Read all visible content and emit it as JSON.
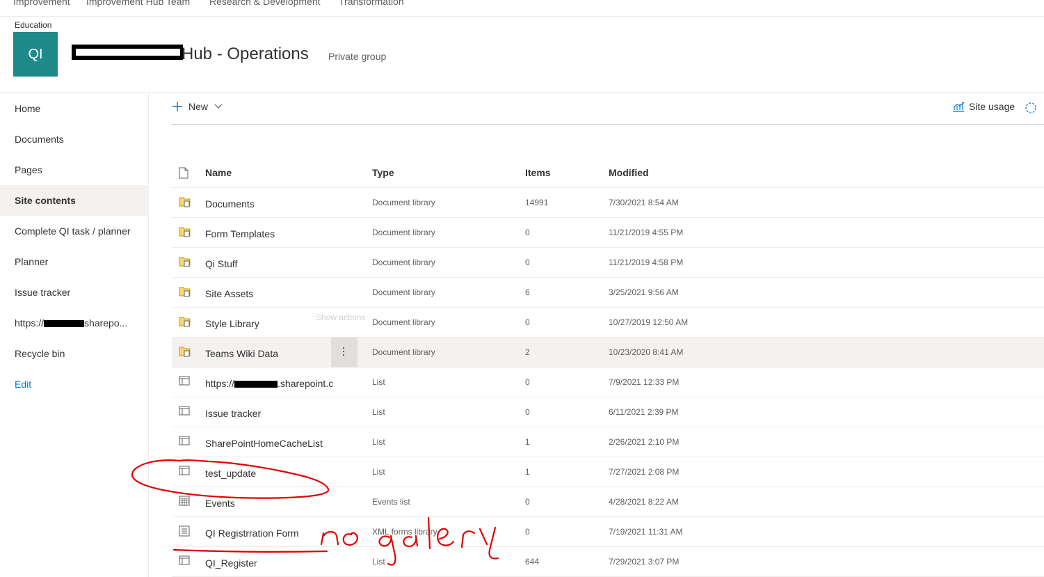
{
  "topnav": {
    "items": [
      "Improvement",
      "Improvement Hub Team",
      "Research & Development",
      "Transformation"
    ]
  },
  "header": {
    "hub_label": "Education",
    "logo_text": "QI",
    "title": "Hub - Operations",
    "group_type": "Private group"
  },
  "leftnav": {
    "items": [
      "Home",
      "Documents",
      "Pages",
      "Site contents",
      "Complete QI task / planner",
      "Planner",
      "Issue tracker",
      "Recycle bin",
      "Edit"
    ],
    "link_prefix": "https://",
    "link_suffix": "sharepo..."
  },
  "commandbar": {
    "new_label": "New",
    "site_usage_label": "Site usage"
  },
  "table": {
    "headers": {
      "name": "Name",
      "type": "Type",
      "items": "Items",
      "modified": "Modified"
    },
    "tooltip": "Show actions",
    "rows": [
      {
        "name": "Documents",
        "type": "Document library",
        "items": "14991",
        "modified": "7/30/2021 8:54 AM",
        "icon": "document-library-icon"
      },
      {
        "name": "Form Templates",
        "type": "Document library",
        "items": "0",
        "modified": "11/21/2019 4:55 PM",
        "icon": "document-library-icon"
      },
      {
        "name": "Qi Stuff",
        "type": "Document library",
        "items": "0",
        "modified": "11/21/2019 4:58 PM",
        "icon": "document-library-icon"
      },
      {
        "name": "Site Assets",
        "type": "Document library",
        "items": "6",
        "modified": "3/25/2021 9:56 AM",
        "icon": "document-library-icon"
      },
      {
        "name": "Style Library",
        "type": "Document library",
        "items": "0",
        "modified": "10/27/2019 12:50 AM",
        "icon": "document-library-icon"
      },
      {
        "name": "Teams Wiki Data",
        "type": "Document library",
        "items": "2",
        "modified": "10/23/2020 8:41 AM",
        "icon": "document-library-icon"
      },
      {
        "name_prefix": "https://",
        "name_suffix": ".sharepoint.c",
        "type": "List",
        "items": "0",
        "modified": "7/9/2021 12:33 PM",
        "icon": "list-icon"
      },
      {
        "name": "Issue tracker",
        "type": "List",
        "items": "0",
        "modified": "6/11/2021 2:39 PM",
        "icon": "list-icon"
      },
      {
        "name": "SharePointHomeCacheList",
        "type": "List",
        "items": "1",
        "modified": "2/26/2021 2:10 PM",
        "icon": "list-icon"
      },
      {
        "name": "test_update",
        "type": "List",
        "items": "1",
        "modified": "7/27/2021 2:08 PM",
        "icon": "list-icon"
      },
      {
        "name": "Events",
        "type": "Events list",
        "items": "0",
        "modified": "4/28/2021 8:22 AM",
        "icon": "calendar-icon"
      },
      {
        "name": "QI Registrration Form",
        "type": "XML forms library",
        "items": "0",
        "modified": "7/19/2021 11:31 AM",
        "icon": "form-library-icon"
      },
      {
        "name": "QI_Register",
        "type": "List",
        "items": "644",
        "modified": "7/29/2021 3:07 PM",
        "icon": "list-icon"
      }
    ]
  },
  "colors": {
    "logo": "#1f8a8a",
    "accent": "#0078d4",
    "annotation": "#e00000"
  }
}
